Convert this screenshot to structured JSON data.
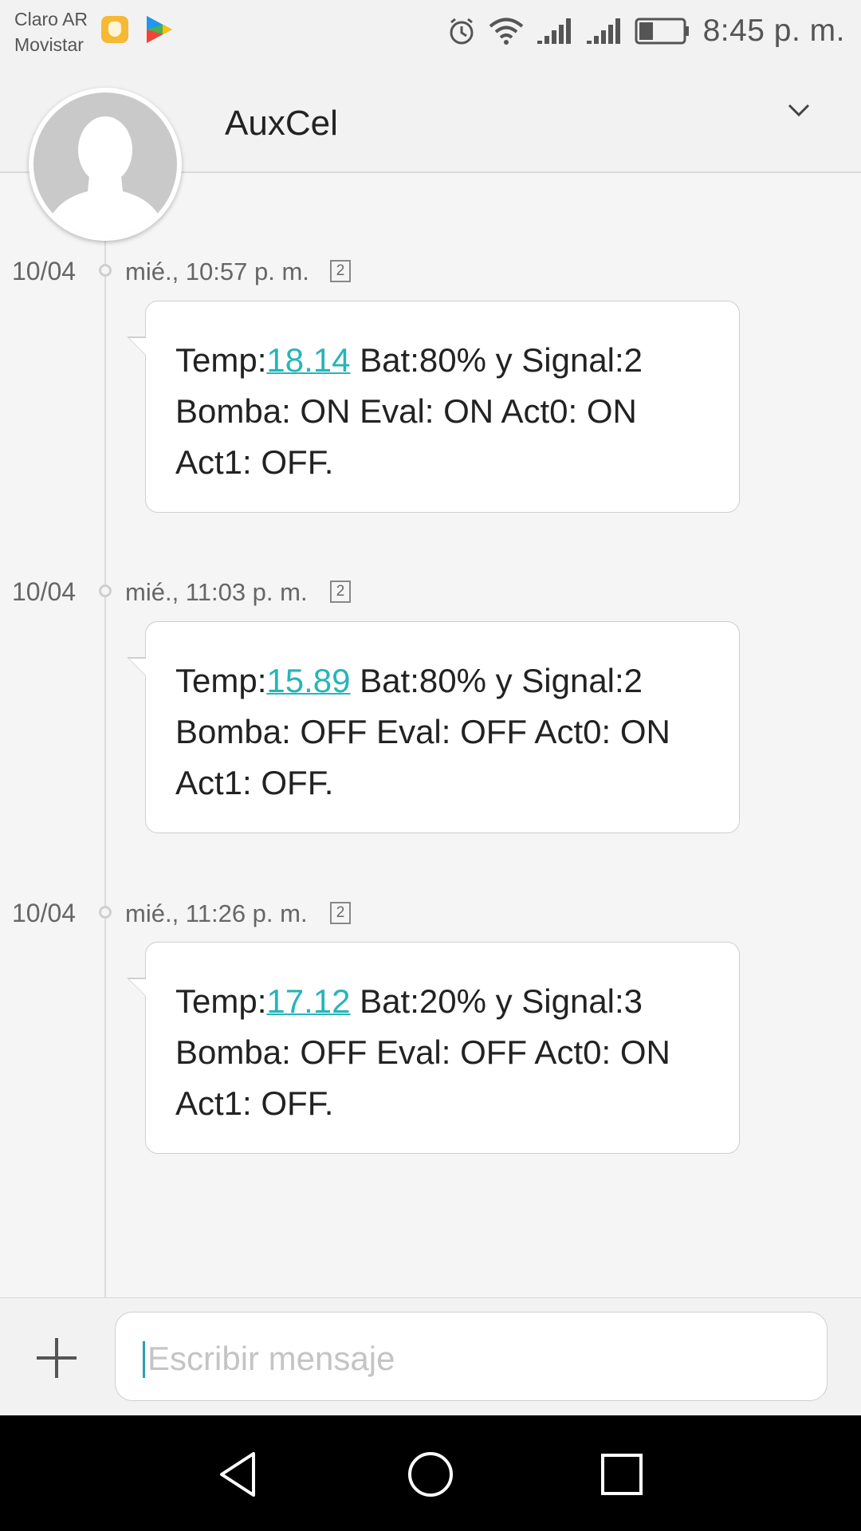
{
  "status_bar": {
    "carrier_1": "Claro AR",
    "carrier_2": "Movistar",
    "time": "8:45 p. m.",
    "icons": [
      "hand-app-icon",
      "play-store-icon",
      "alarm-icon",
      "wifi-icon",
      "signal-1-icon",
      "signal-2-icon",
      "battery-icon"
    ],
    "battery_level": 0.3
  },
  "header": {
    "contact_name": "AuxCel",
    "avatar": "default-person-avatar",
    "expand_icon": "chevron-down-icon"
  },
  "messages": [
    {
      "date": "10/04",
      "time": "mié., 10:57 p. m.",
      "sim": "2",
      "text_before": "Temp:",
      "temp_link": "18.14",
      "text_after": " Bat:80% y Signal:2 Bomba: ON Eval: ON Act0: ON Act1: OFF."
    },
    {
      "date": "10/04",
      "time": "mié., 11:03 p. m.",
      "sim": "2",
      "text_before": "Temp:",
      "temp_link": "15.89",
      "text_after": " Bat:80% y Signal:2 Bomba: OFF Eval: OFF Act0: ON Act1: OFF."
    },
    {
      "date": "10/04",
      "time": "mié., 11:26 p. m.",
      "sim": "2",
      "text_before": "Temp:",
      "temp_link": "17.12",
      "text_after": " Bat:20% y Signal:3 Bomba: OFF Eval: OFF Act0: ON Act1: OFF."
    }
  ],
  "compose": {
    "placeholder": "Escribir mensaje",
    "add_icon": "plus-icon"
  },
  "navbar": {
    "icons": [
      "back-icon",
      "home-icon",
      "recents-icon"
    ]
  },
  "colors": {
    "link": "#26b5b8",
    "background": "#f5f5f5",
    "bubble": "#ffffff"
  }
}
